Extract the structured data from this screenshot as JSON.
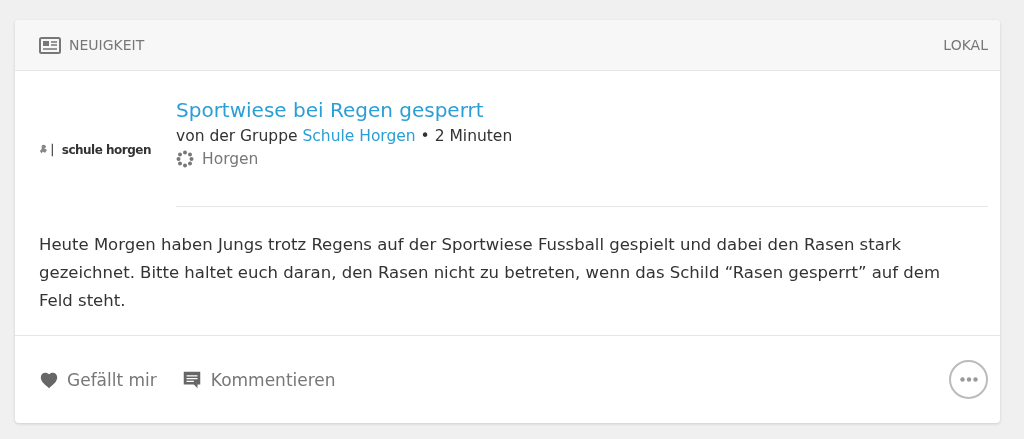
{
  "header": {
    "type_label": "NEUIGKEIT",
    "scope": "LOKAL"
  },
  "post": {
    "logo_text": "schule horgen",
    "title": "Sportwiese bei Regen gesperrt",
    "byline_prefix": "von der Gruppe",
    "group": "Schule Horgen",
    "time": "• 2 Minuten",
    "location": "Horgen",
    "body": "Heute Morgen haben Jungs trotz Regens auf der Sportwiese Fussball gespielt und dabei den Rasen stark gezeichnet. Bitte haltet euch daran, den Rasen nicht zu betreten, wenn das Schild “Rasen gesperrt” auf dem Feld steht."
  },
  "actions": [
    {
      "kind": "like",
      "label": "Gefällt mir"
    },
    {
      "kind": "comment",
      "label": "Kommentieren"
    }
  ]
}
